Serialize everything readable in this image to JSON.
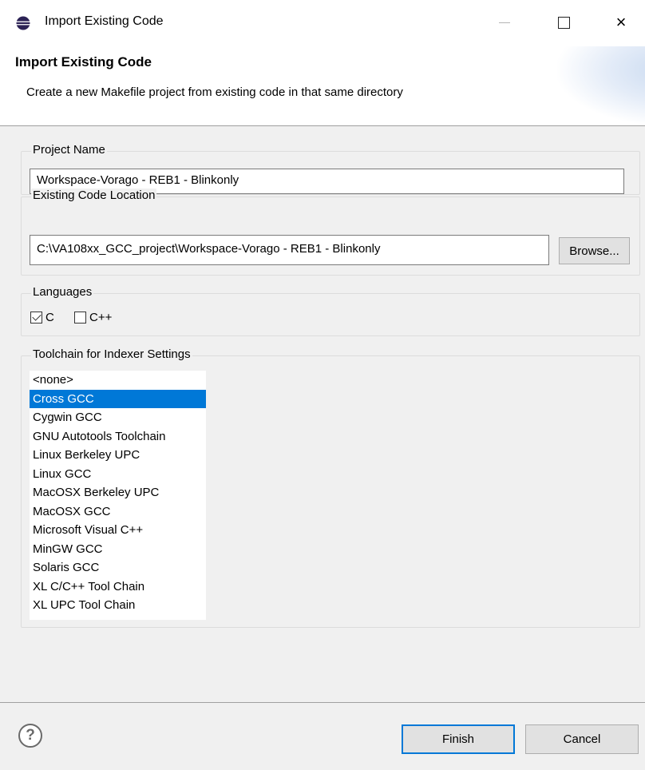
{
  "window": {
    "title": "Import Existing Code",
    "icon": "eclipse-icon",
    "controls": {
      "minimize": "minimize-icon",
      "maximize": "maximize-icon",
      "close": "×"
    }
  },
  "banner": {
    "title": "Import Existing Code",
    "description": "Create a new Makefile project from existing code in that same directory"
  },
  "project_name": {
    "label": "Project Name",
    "value": "Workspace-Vorago - REB1 - Blinkonly"
  },
  "code_location": {
    "label": "Existing Code Location",
    "value": "C:\\VA108xx_GCC_project\\Workspace-Vorago - REB1 - Blinkonly",
    "browse_label": "Browse..."
  },
  "languages": {
    "label": "Languages",
    "options": [
      {
        "label": "C",
        "checked": true
      },
      {
        "label": "C++",
        "checked": false
      }
    ]
  },
  "toolchain": {
    "label": "Toolchain for Indexer Settings",
    "selected": "Cross GCC",
    "items": [
      "<none>",
      "Cross GCC",
      "Cygwin GCC",
      "GNU Autotools Toolchain",
      "Linux Berkeley UPC",
      "Linux GCC",
      "MacOSX Berkeley UPC",
      "MacOSX GCC",
      "Microsoft Visual C++",
      "MinGW GCC",
      "Solaris GCC",
      "XL C/C++ Tool Chain",
      "XL UPC Tool Chain"
    ]
  },
  "footer": {
    "help_icon": "?",
    "finish_label": "Finish",
    "cancel_label": "Cancel"
  },
  "colors": {
    "selection": "#0078d7",
    "dialog_bg": "#f0f0f0",
    "default_button_border": "#0078d7"
  }
}
